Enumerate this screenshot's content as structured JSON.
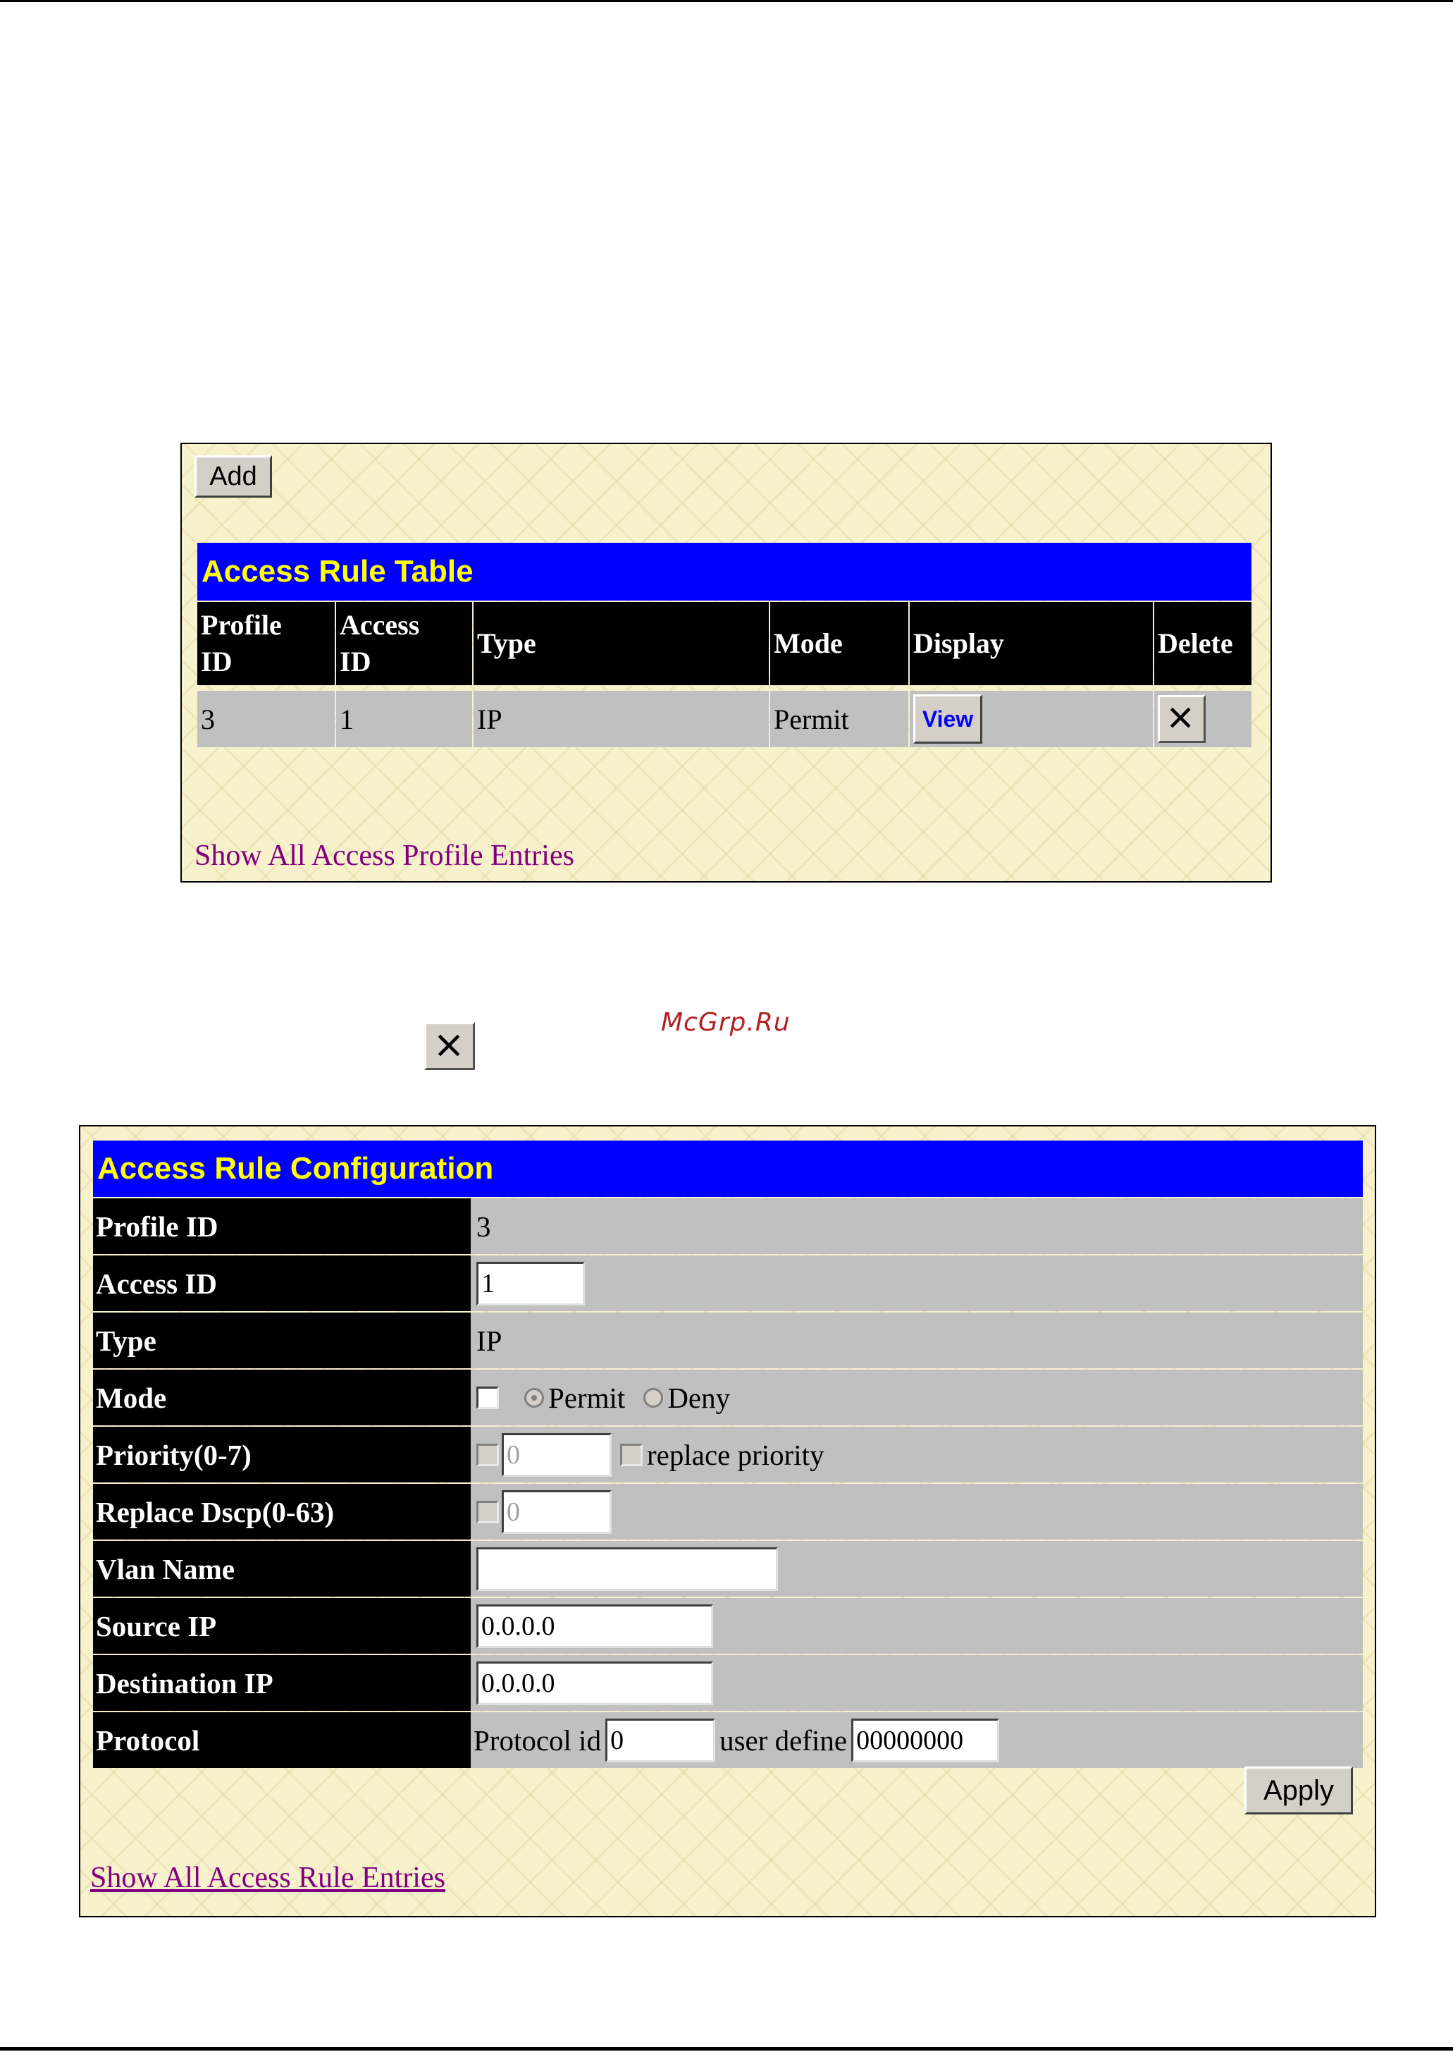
{
  "watermark": "McGrp.Ru",
  "rule_table": {
    "add_label": "Add",
    "title": "Access Rule Table",
    "columns": {
      "profile_id": [
        "Profile",
        "ID"
      ],
      "access_id": [
        "Access",
        "ID"
      ],
      "type": "Type",
      "mode": "Mode",
      "display": "Display",
      "delete": "Delete"
    },
    "rows": [
      {
        "profile_id": "3",
        "access_id": "1",
        "type": "IP",
        "mode": "Permit",
        "display_button": "View"
      }
    ],
    "show_all_link": "Show All Access Profile Entries"
  },
  "delete_icon_name": "close-icon",
  "config": {
    "title": "Access Rule Configuration",
    "rows": {
      "profile_id": {
        "label": "Profile ID",
        "value": "3"
      },
      "access_id": {
        "label": "Access ID",
        "value": "1"
      },
      "type": {
        "label": "Type",
        "value": "IP"
      },
      "mode": {
        "label": "Mode",
        "permit": "Permit",
        "deny": "Deny",
        "selected": "Permit"
      },
      "priority": {
        "label": "Priority(0-7)",
        "value": "0",
        "replace_label": "replace priority"
      },
      "replace_dscp": {
        "label": "Replace Dscp(0-63)",
        "value": "0"
      },
      "vlan_name": {
        "label": "Vlan Name",
        "value": ""
      },
      "source_ip": {
        "label": "Source IP",
        "value": "0.0.0.0"
      },
      "destination_ip": {
        "label": "Destination IP",
        "value": "0.0.0.0"
      },
      "protocol": {
        "label": "Protocol",
        "protocol_id_label": "Protocol id",
        "protocol_id": "0",
        "user_define_label": "user define",
        "user_define": "00000000"
      }
    },
    "apply_label": "Apply",
    "show_all_link": "Show All Access Rule Entries"
  },
  "colors": {
    "title_bg": "#0000ff",
    "title_text": "#ffff00",
    "header_bg": "#000000",
    "cell_bg": "#c0c0c0",
    "link": "#800080",
    "panel_bg": "#f7f1cc",
    "view_text": "#0000ff"
  }
}
